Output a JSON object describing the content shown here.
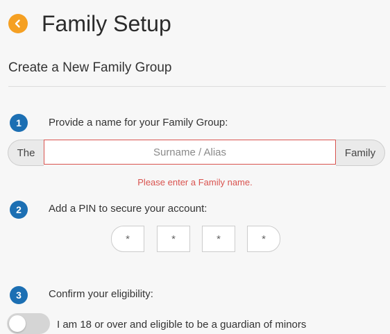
{
  "header": {
    "title": "Family Setup",
    "back_icon": "arrow-left-icon",
    "accent_color": "#f5a023"
  },
  "subtitle": "Create a New Family Group",
  "steps": [
    {
      "number": "1",
      "label": "Provide a name for your Family Group:"
    },
    {
      "number": "2",
      "label": "Add a PIN to secure your account:"
    },
    {
      "number": "3",
      "label": "Confirm your eligibility:"
    }
  ],
  "name_group": {
    "prefix": "The",
    "suffix": "Family",
    "value": "",
    "placeholder": "Surname / Alias",
    "error": "Please enter a Family name.",
    "error_color": "#d9534f"
  },
  "pin": {
    "placeholders": [
      "*",
      "*",
      "*",
      "*"
    ]
  },
  "eligibility": {
    "toggle_on": false,
    "label": "I am 18 or over and eligible to be a guardian of minors"
  },
  "step_badge_color": "#1c6fb3"
}
